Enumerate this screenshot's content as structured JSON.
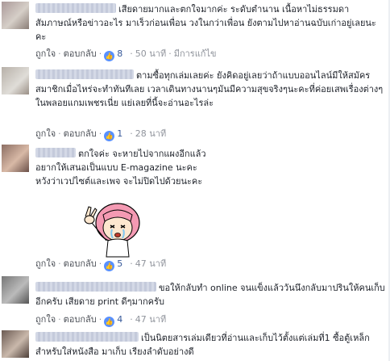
{
  "comments": [
    {
      "text": "เสียดายมากและตกใจมากค่ะ ระดับตำนาน เนื้อหาไม่ธรรมดา สัมภาษณ์หรือข่าวอะไร มาเร็วก่อนเพื่อน วงในกว่าเพื่อน ยังตามไปหาอ่านฉบับเก่าอยู่เลยนะคะ",
      "like_label": "ถูกใจ",
      "reply_label": "ตอบกลับ",
      "likes": "8",
      "time": "50 นาที",
      "edited": "มีการแก้ไข"
    },
    {
      "text": "ตามซื้อทุกเล่มเลยค่ะ ยังคิดอยู่เลยว่าถ้าแบบออนไลน์มีให้สมัครสมาชิกเมื่อไหร่จะทำทันทีเลย เวลาเดินทางนานๆมันมีความสุขจริงๆนะคะที่ค่อยเสพเรื่องต่างๆในพลอยแกมเพชรเนี่ย แย่เลยที่นี้จะอ่านอะไรล่ะ",
      "like_label": "ถูกใจ",
      "reply_label": "ตอบกลับ",
      "likes": "1",
      "time": "28 นาที"
    },
    {
      "text": "ตกใจค่ะ จะหายไปจากแผงอีกแล้ว\nอยากให้เสนอเป็นแบบ E-magazine นะคะ\nหวังว่าเวปไซต์และเพจ จะไม่ปิดไปด้วยนะคะ",
      "like_label": "ถูกใจ",
      "reply_label": "ตอบกลับ",
      "likes": "5",
      "time": "47 นาที",
      "sticker": "sticker-crying-pink-hair-girl"
    },
    {
      "text": "ขอให้กลับทำ online จนแข็งแล้ววันนึงกลับมาปรินให้คนเก็บอีกครับ เสียดาย print ดีๆมากครับ",
      "like_label": "ถูกใจ",
      "reply_label": "ตอบกลับ",
      "likes": "4",
      "time": "47 นาที"
    },
    {
      "text": "เป็นนิตยสารเล่มเดียวที่อ่านและเก็บไว้ตั้งแต่เล่มที่1 ซื้อตู้เหล็กสำหรับใส่หนังสือ มาเก็บ เรียงลำดับอย่างดี"
    }
  ],
  "icons": {
    "like": "thumbs-up-icon"
  },
  "colors": {
    "like_blue": "#5890ff",
    "link": "#365899",
    "meta": "#90949c"
  }
}
